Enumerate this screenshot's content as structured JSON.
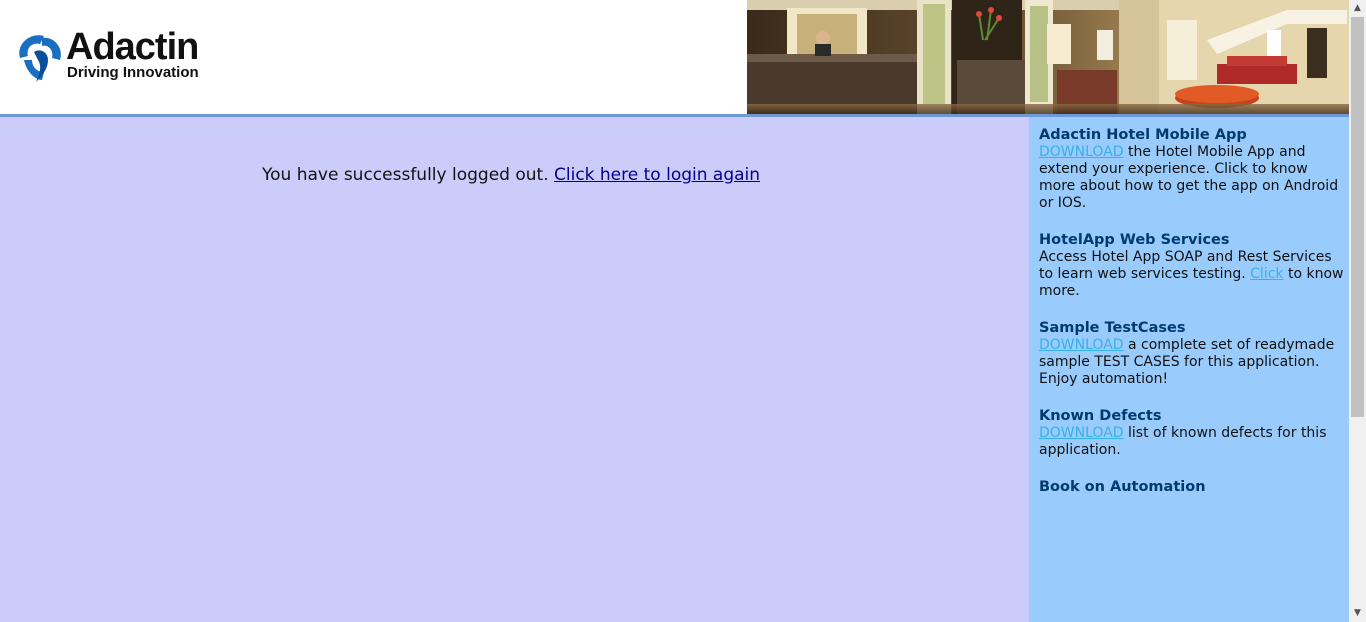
{
  "header": {
    "logo_title": "Adactin",
    "logo_tagline": "Driving Innovation"
  },
  "main": {
    "logout_message": "You have successfully logged out.",
    "login_link": "Click here to login again"
  },
  "sidebar": {
    "sections": [
      {
        "title": "Adactin Hotel Mobile App",
        "link": "DOWNLOAD",
        "text_after": " the Hotel Mobile App and extend your experience. Click to know more about how to get the app on Android or IOS."
      },
      {
        "title": "HotelApp Web Services",
        "text_before": "Access Hotel App SOAP and Rest Services to learn web services testing. ",
        "link": "Click",
        "text_after": " to know more."
      },
      {
        "title": "Sample TestCases",
        "link": "DOWNLOAD",
        "text_after": " a complete set of readymade sample TEST CASES for this application. Enjoy automation!"
      },
      {
        "title": "Known Defects",
        "link": "DOWNLOAD",
        "text_after": " list of known defects for this application."
      },
      {
        "title": "Book on Automation"
      }
    ]
  },
  "colors": {
    "main_bg": "#ccccfb",
    "sidebar_bg": "#99ccfd",
    "sidebar_title": "#003a6e",
    "sidebar_link": "#38b0e8",
    "main_link": "#00008b"
  }
}
